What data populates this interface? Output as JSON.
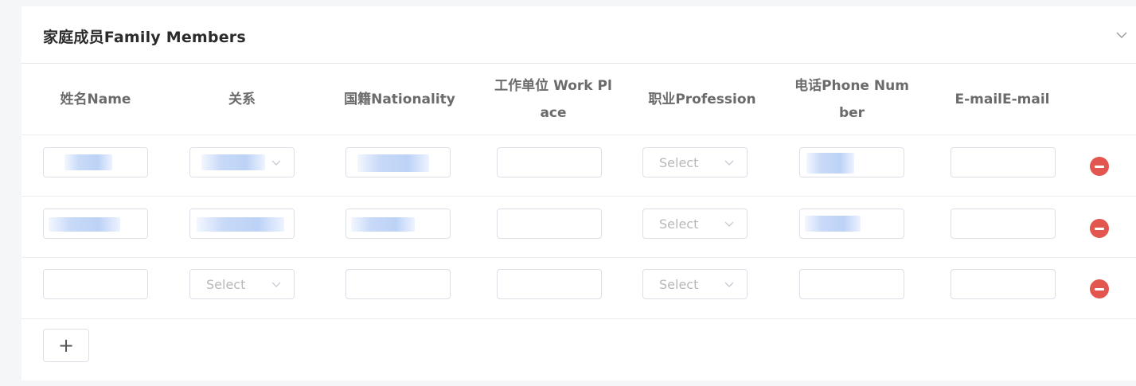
{
  "section": {
    "title": "家庭成员Family Members",
    "collapse_icon": "chevron-down-icon"
  },
  "table": {
    "columns": [
      {
        "line1": "姓名Name",
        "line2": ""
      },
      {
        "line1": "关系",
        "line2": ""
      },
      {
        "line1": "国籍Nationality",
        "line2": ""
      },
      {
        "line1": "工作单位 Work Pl",
        "line2": "ace"
      },
      {
        "line1": "职业Profession",
        "line2": ""
      },
      {
        "line1": "电话Phone Num",
        "line2": "ber"
      },
      {
        "line1": "E-mailE-mail",
        "line2": ""
      }
    ],
    "select_placeholder": "Select",
    "rows": [
      {
        "name": "[redacted]",
        "relation": "[redacted]",
        "nationality": "[redacted]",
        "work_place": "",
        "profession": "",
        "phone": "[redacted]",
        "email": ""
      },
      {
        "name": "[redacted]",
        "relation": "[redacted]",
        "nationality": "[redacted]",
        "work_place": "",
        "profession": "",
        "phone": "[redacted]",
        "email": ""
      },
      {
        "name": "",
        "relation": "",
        "nationality": "",
        "work_place": "",
        "profession": "",
        "phone": "",
        "email": ""
      }
    ],
    "remove_icon": "minus-circle-icon",
    "add_button": "+",
    "colors": {
      "remove": "#e2564f",
      "placeholder": "#b8b8b8",
      "border": "#dcdfe6"
    }
  }
}
